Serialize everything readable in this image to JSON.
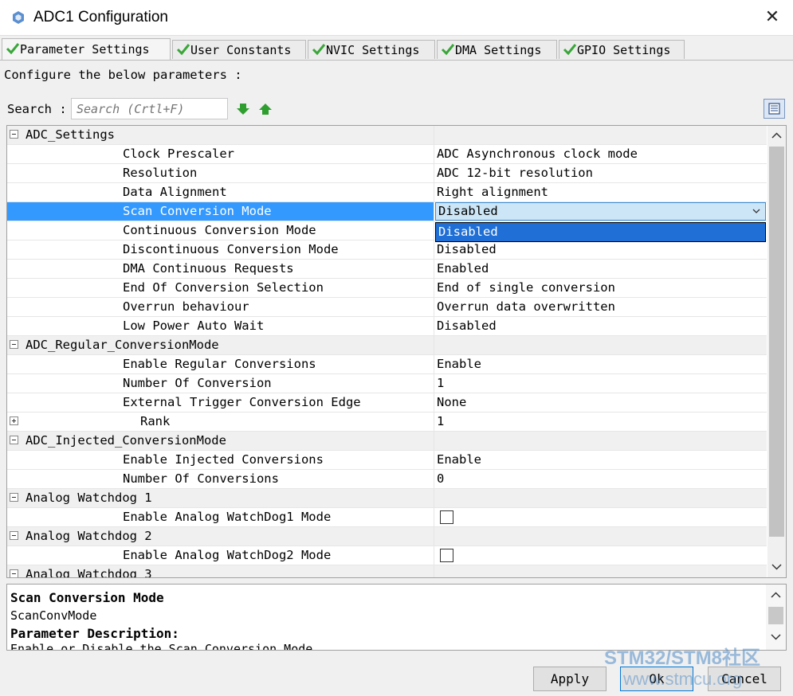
{
  "window": {
    "title": "ADC1 Configuration"
  },
  "tabs": [
    {
      "label": "Parameter Settings",
      "active": true
    },
    {
      "label": "User Constants",
      "active": false
    },
    {
      "label": "NVIC Settings",
      "active": false
    },
    {
      "label": "DMA Settings",
      "active": false
    },
    {
      "label": "GPIO Settings",
      "active": false
    }
  ],
  "instructions": "Configure the below parameters :",
  "search": {
    "label": "Search :",
    "placeholder": "Search (Crtl+F)"
  },
  "grid": {
    "rows": [
      {
        "kind": "group",
        "name": "ADC_Settings",
        "expander": "minus"
      },
      {
        "kind": "param",
        "name": "Clock Prescaler",
        "value": "ADC Asynchronous clock mode"
      },
      {
        "kind": "param",
        "name": "Resolution",
        "value": "ADC 12-bit resolution"
      },
      {
        "kind": "param",
        "name": "Data Alignment",
        "value": "Right alignment"
      },
      {
        "kind": "param",
        "name": "Scan Conversion Mode",
        "value": "Disabled",
        "selected": true,
        "editor": "combo"
      },
      {
        "kind": "param",
        "name": "Continuous Conversion Mode",
        "value": ""
      },
      {
        "kind": "param",
        "name": "Discontinuous Conversion Mode",
        "value": "Disabled"
      },
      {
        "kind": "param",
        "name": "DMA Continuous Requests",
        "value": "Enabled"
      },
      {
        "kind": "param",
        "name": "End Of Conversion Selection",
        "value": "End of single conversion"
      },
      {
        "kind": "param",
        "name": "Overrun behaviour",
        "value": "Overrun data overwritten"
      },
      {
        "kind": "param",
        "name": "Low Power Auto Wait",
        "value": "Disabled"
      },
      {
        "kind": "group",
        "name": "ADC_Regular_ConversionMode",
        "expander": "minus"
      },
      {
        "kind": "param",
        "name": "Enable Regular Conversions",
        "value": "Enable"
      },
      {
        "kind": "param",
        "name": "Number Of Conversion",
        "value": "1"
      },
      {
        "kind": "param",
        "name": "External Trigger Conversion Edge",
        "value": "None"
      },
      {
        "kind": "param",
        "name": "Rank",
        "value": "1",
        "expander": "plus",
        "indent": true
      },
      {
        "kind": "group",
        "name": "ADC_Injected_ConversionMode",
        "expander": "minus"
      },
      {
        "kind": "param",
        "name": "Enable Injected Conversions",
        "value": "Enable"
      },
      {
        "kind": "param",
        "name": "Number Of Conversions",
        "value": "0"
      },
      {
        "kind": "group",
        "name": "Analog Watchdog 1",
        "expander": "minus"
      },
      {
        "kind": "param",
        "name": "Enable Analog WatchDog1 Mode",
        "value": "",
        "editor": "checkbox",
        "checked": false
      },
      {
        "kind": "group",
        "name": "Analog Watchdog 2",
        "expander": "minus"
      },
      {
        "kind": "param",
        "name": "Enable Analog WatchDog2 Mode",
        "value": "",
        "editor": "checkbox",
        "checked": false
      },
      {
        "kind": "group",
        "name": "Analog Watchdog 3",
        "expander": "minus"
      }
    ],
    "dropdown_option": "Disabled"
  },
  "description": {
    "title": "Scan Conversion Mode",
    "id": "ScanConvMode",
    "heading": "Parameter Description:",
    "text": "Enable or Disable the Scan Conversion Mode"
  },
  "buttons": {
    "apply": "Apply",
    "ok": "Ok",
    "cancel": "Cancel"
  },
  "watermark": {
    "line1": "STM32/STM8社区",
    "line2": "www.stmcu.org"
  },
  "colors": {
    "selection": "#3399ff",
    "dropdown_highlight": "#1f6fd6",
    "check_green": "#3aa63a",
    "arrow_green": "#2e9e2e"
  }
}
